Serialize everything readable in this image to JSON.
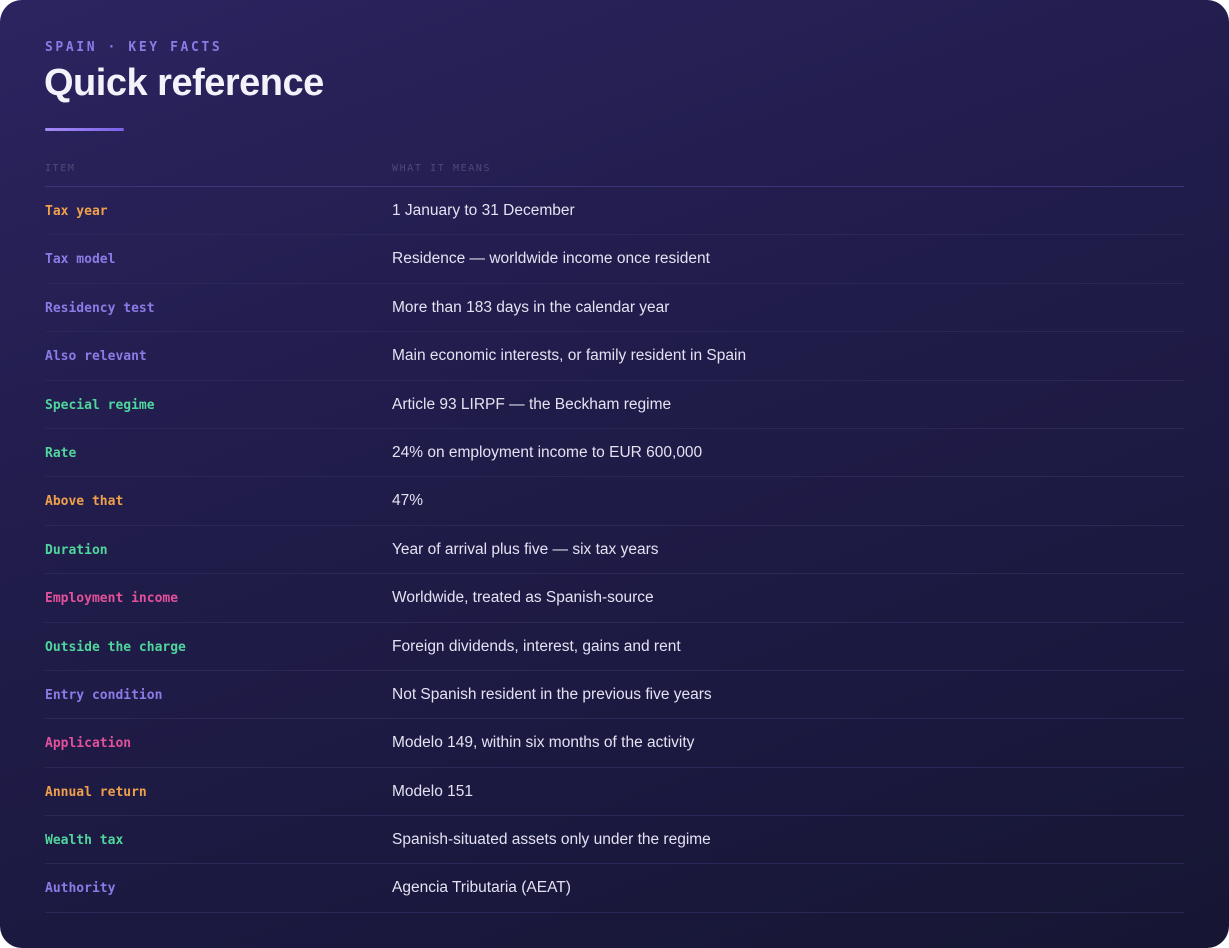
{
  "header": {
    "eyebrow": "SPAIN · KEY FACTS",
    "title": "Quick reference"
  },
  "table": {
    "columns": [
      "ITEM",
      "WHAT IT MEANS"
    ],
    "rows": [
      {
        "label": "Tax year",
        "value": "1 January to 31 December",
        "color": "#f0a04b"
      },
      {
        "label": "Tax model",
        "value": "Residence — worldwide income once resident",
        "color": "#8b7be6"
      },
      {
        "label": "Residency test",
        "value": "More than 183 days in the calendar year",
        "color": "#8b7be6"
      },
      {
        "label": "Also relevant",
        "value": "Main economic interests, or family resident in Spain",
        "color": "#8b7be6"
      },
      {
        "label": "Special regime",
        "value": "Article 93 LIRPF — the Beckham regime",
        "color": "#4fd69c"
      },
      {
        "label": "Rate",
        "value": "24% on employment income to EUR 600,000",
        "color": "#4fd69c"
      },
      {
        "label": "Above that",
        "value": "47%",
        "color": "#f0a04b"
      },
      {
        "label": "Duration",
        "value": "Year of arrival plus five — six tax years",
        "color": "#4fd69c"
      },
      {
        "label": "Employment income",
        "value": "Worldwide, treated as Spanish-source",
        "color": "#e2519a"
      },
      {
        "label": "Outside the charge",
        "value": "Foreign dividends, interest, gains and rent",
        "color": "#4fd69c"
      },
      {
        "label": "Entry condition",
        "value": "Not Spanish resident in the previous five years",
        "color": "#8b7be6"
      },
      {
        "label": "Application",
        "value": "Modelo 149, within six months of the activity",
        "color": "#e2519a"
      },
      {
        "label": "Annual return",
        "value": "Modelo 151",
        "color": "#f0a04b"
      },
      {
        "label": "Wealth tax",
        "value": "Spanish-situated assets only under the regime",
        "color": "#4fd69c"
      },
      {
        "label": "Authority",
        "value": "Agencia Tributaria (AEAT)",
        "color": "#8b7be6"
      }
    ]
  }
}
